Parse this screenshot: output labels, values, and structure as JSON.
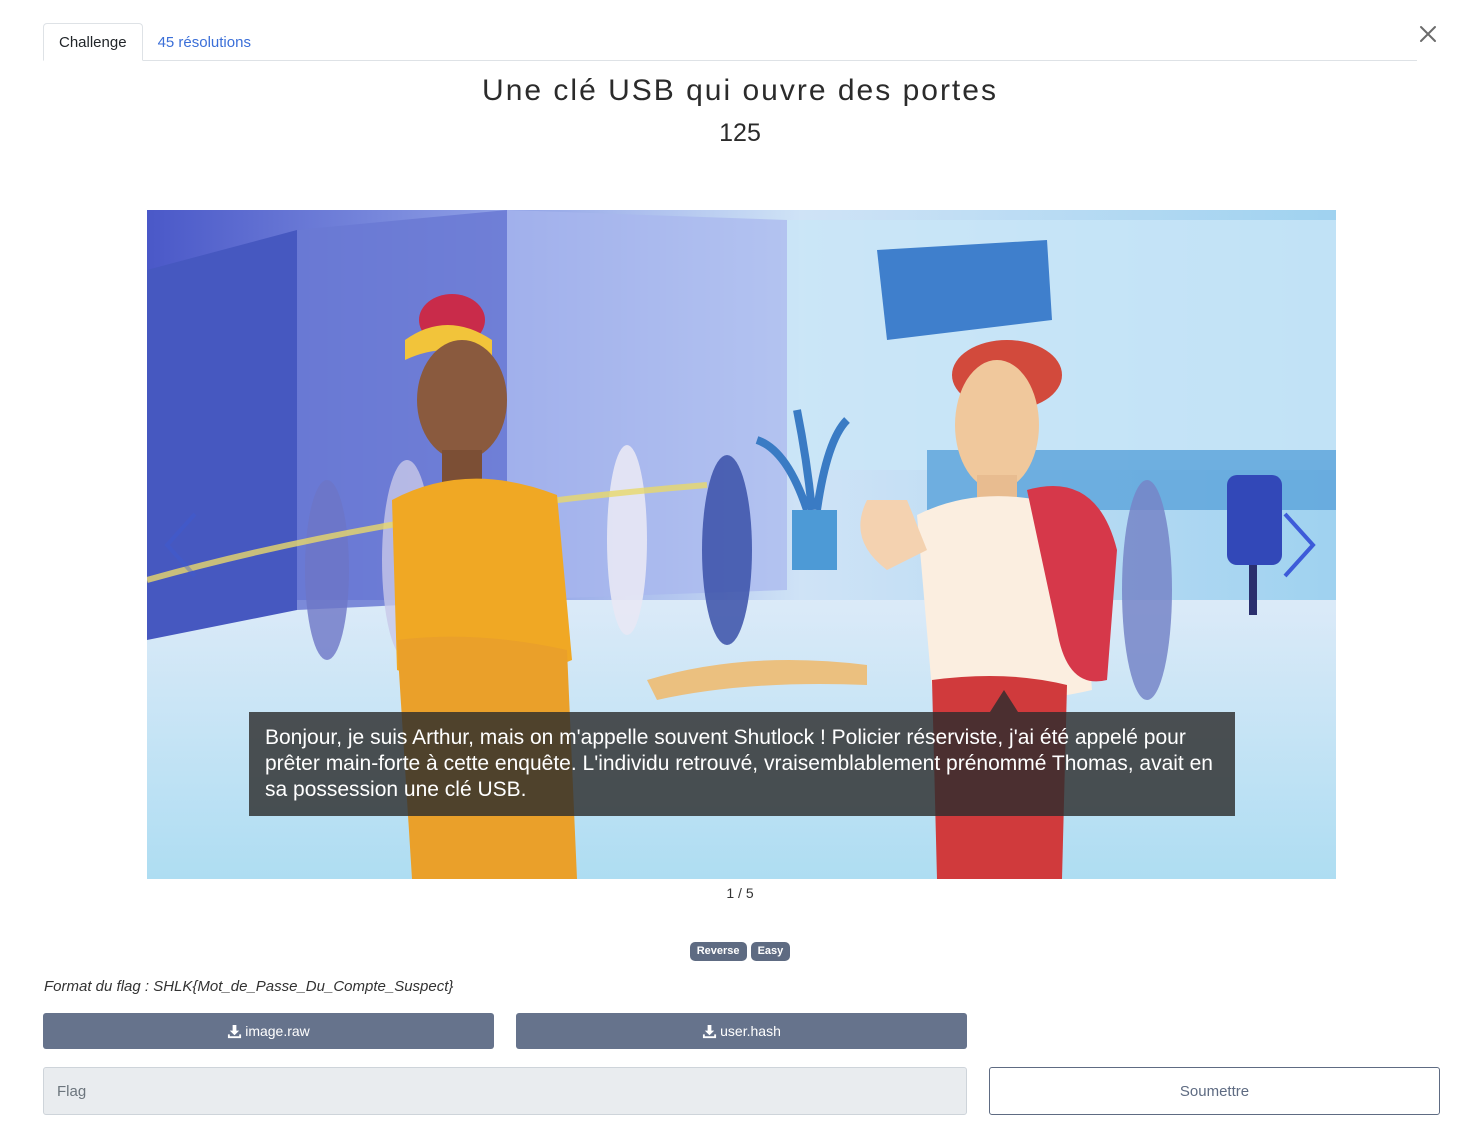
{
  "tabs": [
    {
      "label": "Challenge",
      "active": true
    },
    {
      "label": "45 résolutions",
      "active": false
    }
  ],
  "challenge": {
    "title": "Une clé USB qui ouvre des portes",
    "points": "125"
  },
  "carousel": {
    "caption": "Bonjour, je suis Arthur, mais on m'appelle souvent Shutlock ! Policier réserviste, j'ai été appelé pour prêter main-forte à cette enquête. L'individu retrouvé, vraisemblablement prénommé Thomas, avait en sa possession une clé USB.",
    "counter": "1 / 5"
  },
  "tags": [
    "Reverse",
    "Easy"
  ],
  "flag_format": "Format du flag : SHLK{Mot_de_Passe_Du_Compte_Suspect}",
  "files": [
    {
      "label": "image.raw",
      "icon": "download-icon"
    },
    {
      "label": "user.hash",
      "icon": "download-icon"
    }
  ],
  "flag_input": {
    "placeholder": "Flag",
    "value": ""
  },
  "submit_label": "Soumettre",
  "colors": {
    "accent": "#3b6fd8",
    "tag_bg": "#5e6b82",
    "button_bg": "#66738c",
    "carousel_arrow": "#3d5bd9"
  }
}
